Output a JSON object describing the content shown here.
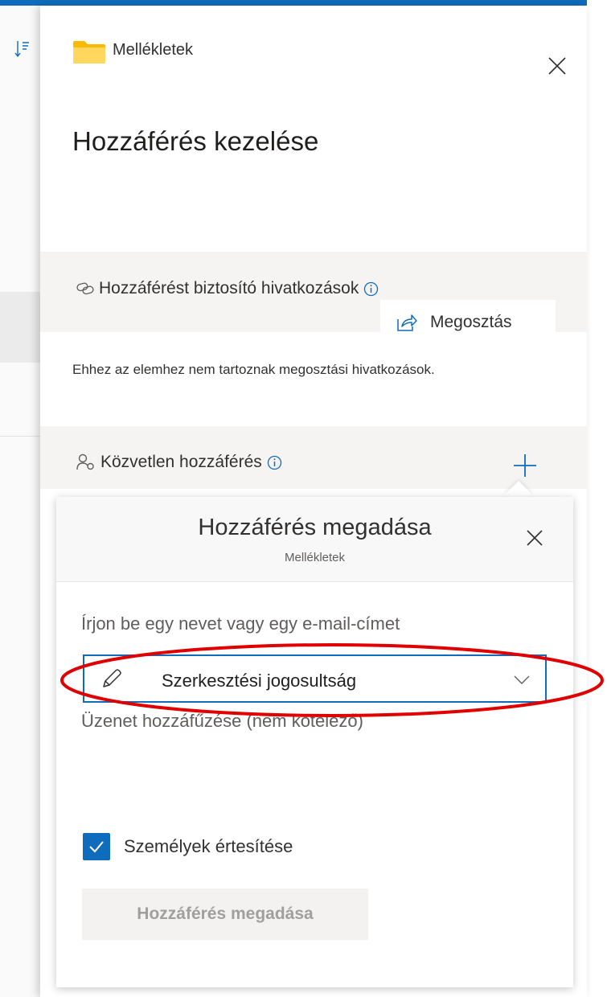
{
  "panel": {
    "folder_name": "Mellékletek",
    "title": "Hozzáférés kezelése",
    "links_section": {
      "heading": "Hozzáférést biztosító hivatkozások",
      "share_button": "Megosztás",
      "empty_message": "Ehhez az elemhez nem tartoznak megosztási hivatkozások."
    },
    "direct_section": {
      "heading": "Közvetlen hozzáférés"
    }
  },
  "popup": {
    "title": "Hozzáférés megadása",
    "subtitle": "Mellékletek",
    "name_placeholder": "Írjon be egy nevet vagy egy e-mail-címet",
    "permission_value": "Szerkesztési jogosultság",
    "message_placeholder": "Üzenet hozzáfűzése (nem kötelező)",
    "notify_label": "Személyek értesítése",
    "notify_checked": true,
    "grant_button": "Hozzáférés megadása"
  },
  "colors": {
    "accent": "#0f6cbd",
    "annotation": "#e00000",
    "folder": "#ffb900"
  },
  "icons": [
    "sort-icon",
    "folder-icon",
    "close-icon",
    "link-icon",
    "info-icon",
    "share-icon",
    "people-icon",
    "plus-icon",
    "pencil-icon",
    "chevron-down-icon",
    "checkmark-icon"
  ]
}
